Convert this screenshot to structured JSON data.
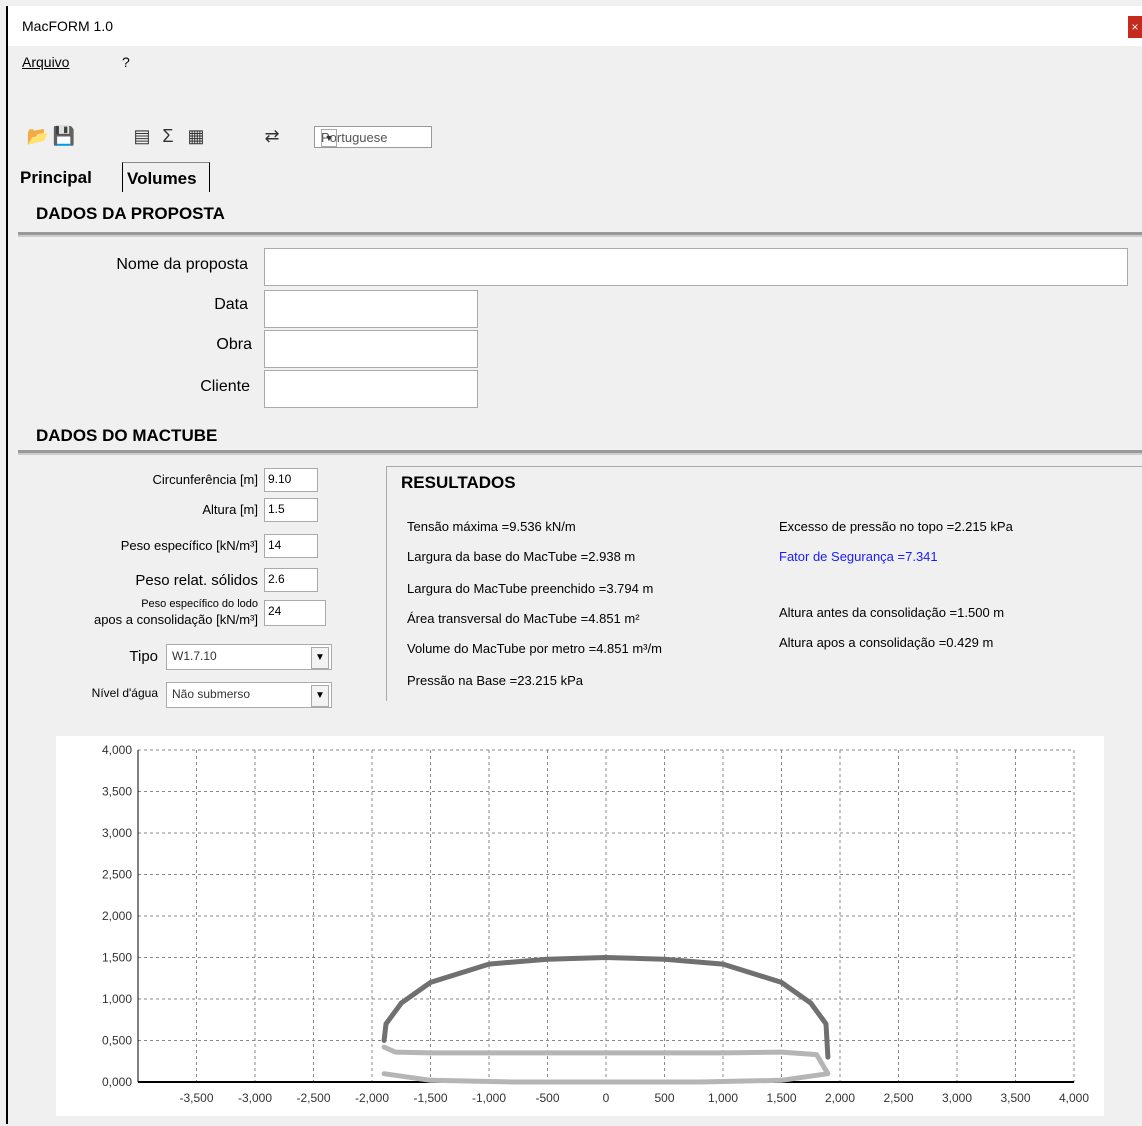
{
  "window": {
    "title": "MacFORM 1.0",
    "close_icon": "×"
  },
  "menu": {
    "file": "Arquivo",
    "help": "?"
  },
  "toolbar": {
    "language": "Portuguese"
  },
  "tabs": [
    "Principal",
    "Volumes"
  ],
  "proposal_section": {
    "title": "DADOS DA PROPOSTA",
    "name_label": "Nome da proposta",
    "date_label": "Data",
    "work_label": "Obra",
    "client_label": "Cliente",
    "name_value": "",
    "date_value": "",
    "work_value": "",
    "client_value": ""
  },
  "mactube_section": {
    "title": "DADOS DO MACTUBE",
    "circ_label": "Circunferência [m]",
    "circ_value": "9.10",
    "height_label": "Altura [m]",
    "height_value": "1.5",
    "spec_weight_label": "Peso específico [kN/m³]",
    "spec_weight_value": "14",
    "rel_weight_label": "Peso relat. sólidos",
    "rel_weight_value": "2.6",
    "sludge_label_1": "Peso específico do lodo",
    "sludge_label_2": "apos a consolidação [kN/m³]",
    "sludge_value": "24",
    "type_label": "Tipo",
    "type_value": "W1.7.10",
    "water_label": "Nível d'água",
    "water_value": "Não submerso"
  },
  "results": {
    "title": "RESULTADOS",
    "max_tension": "Tensão máxima =9.536 kN/m",
    "base_width": "Largura da base do MacTube =2.938 m",
    "filled_width": "Largura do MacTube preenchido =3.794 m",
    "area": "Área transversal do MacTube =4.851 m²",
    "volume": "Volume do MacTube por metro =4.851 m³/m",
    "base_pressure": "Pressão na Base =23.215 kPa",
    "top_pressure": "Excesso de pressão no topo =2.215 kPa",
    "safety_factor": "Fator de Segurança =7.341",
    "height_before": "Altura antes da consolidação =1.500 m",
    "height_after": "Altura apos a consolidação =0.429 m",
    "safety_color": "#1a1aff"
  },
  "chart_data": {
    "type": "line",
    "y_ticks": [
      "0,000",
      "0,500",
      "1,000",
      "1,500",
      "2,000",
      "2,500",
      "3,000",
      "3,500",
      "4,000"
    ],
    "x_ticks": [
      "-3,500",
      "-3,000",
      "-2,500",
      "-2,000",
      "-1,500",
      "-1,000",
      "-500",
      "0",
      "500",
      "1,000",
      "1,500",
      "2,000",
      "2,500",
      "3,000",
      "3,500",
      "4,000"
    ],
    "ylim": [
      0,
      4
    ],
    "xlim": [
      -4,
      4
    ],
    "grid": true,
    "series": [
      {
        "color": "#707070",
        "x": [
          -1.897,
          -1.88,
          -1.75,
          -1.5,
          -1.0,
          -0.5,
          0,
          0.5,
          1.0,
          1.5,
          1.75,
          1.88,
          1.897
        ],
        "y": [
          0.5,
          0.7,
          0.95,
          1.2,
          1.42,
          1.48,
          1.5,
          1.48,
          1.42,
          1.2,
          0.95,
          0.7,
          0.3
        ]
      },
      {
        "color": "#b5b5b5",
        "x": [
          -1.897,
          -1.8,
          -1.5,
          -1.0,
          0,
          1.0,
          1.5,
          1.8,
          1.897,
          1.5,
          0.8,
          0,
          -0.8,
          -1.5,
          -1.897
        ],
        "y": [
          0.42,
          0.36,
          0.35,
          0.35,
          0.35,
          0.35,
          0.36,
          0.33,
          0.1,
          0.02,
          0.0,
          0.0,
          0.0,
          0.02,
          0.1
        ]
      }
    ]
  }
}
